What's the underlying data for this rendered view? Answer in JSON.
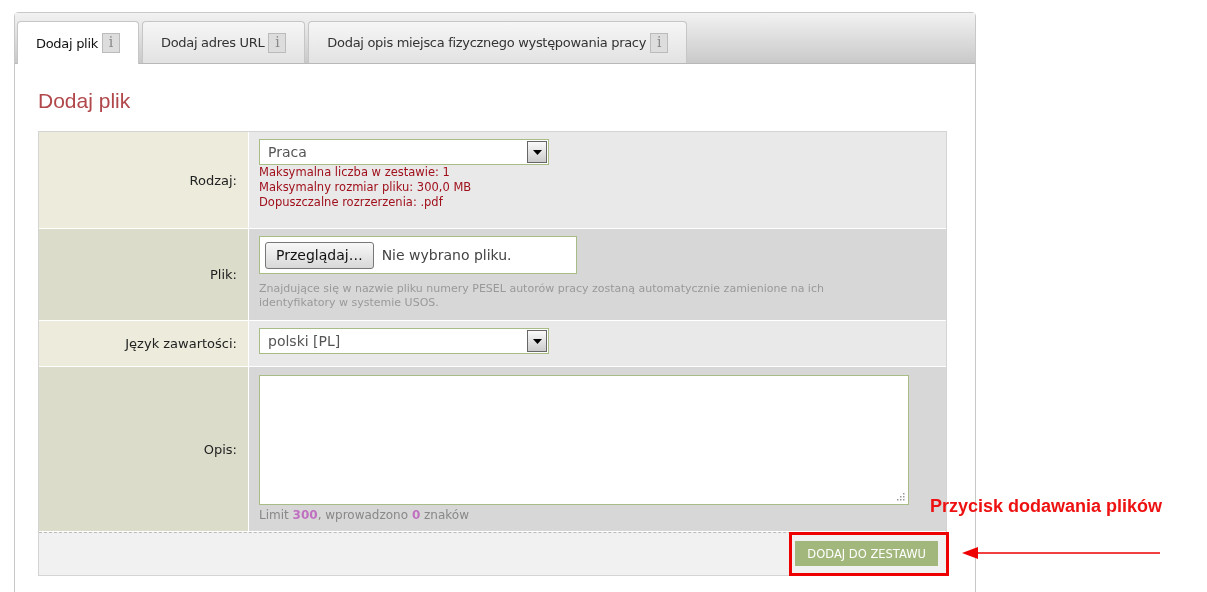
{
  "tabs": [
    {
      "label": "Dodaj plik",
      "info": "i",
      "selected": true
    },
    {
      "label": "Dodaj adres URL",
      "info": "i",
      "selected": false
    },
    {
      "label": "Dodaj opis miejsca fizycznego występowania pracy",
      "info": "i",
      "selected": false
    }
  ],
  "heading": "Dodaj plik",
  "form": {
    "rows": [
      {
        "kind": "select",
        "label": "Rodzaj:",
        "value": "Praca",
        "notes": [
          "Maksymalna liczba w zestawie: 1",
          "Maksymalny rozmiar pliku: 300,0 MB",
          "Dopuszczalne rozrzerzenia: .pdf"
        ]
      },
      {
        "kind": "file",
        "label": "Plik:",
        "button": "Przeglądaj…",
        "status": "Nie wybrano pliku.",
        "hint": "Znajdujące się w nazwie pliku numery PESEL autorów pracy zostaną automatycznie zamienione na ich identyfikatory w systemie USOS."
      },
      {
        "kind": "select",
        "label": "Język zawartości:",
        "value": "polski [PL]"
      },
      {
        "kind": "textarea",
        "label": "Opis:",
        "counter": "Limit **300**, wprowadzono **0** znaków"
      }
    ]
  },
  "submit": "DODAJ DO ZESTAWU",
  "annotation": {
    "text": "Przycisk dodawania plików"
  }
}
